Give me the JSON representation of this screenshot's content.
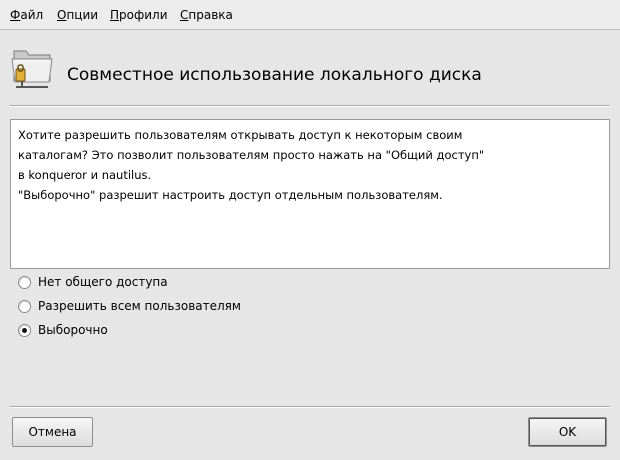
{
  "menu": [
    "Файл",
    "Опции",
    "Профили",
    "Справка"
  ],
  "header": {
    "title": "Совместное использование локального диска",
    "icon": "shared-folder-icon"
  },
  "description": [
    "Хотите разрешить пользователям открывать доступ к некоторым своим",
    "каталогам? Это позволит пользователям просто нажать на \"Общий доступ\"",
    "в konqueror и nautilus.",
    "\"Выборочно\" разрешит настроить доступ отдельным пользователям."
  ],
  "options": [
    {
      "label": "Нет общего доступа",
      "checked": false
    },
    {
      "label": "Разрешить всем пользователям",
      "checked": false
    },
    {
      "label": "Выборочно",
      "checked": true
    }
  ],
  "buttons": {
    "cancel": "Отмена",
    "ok": "OK"
  }
}
